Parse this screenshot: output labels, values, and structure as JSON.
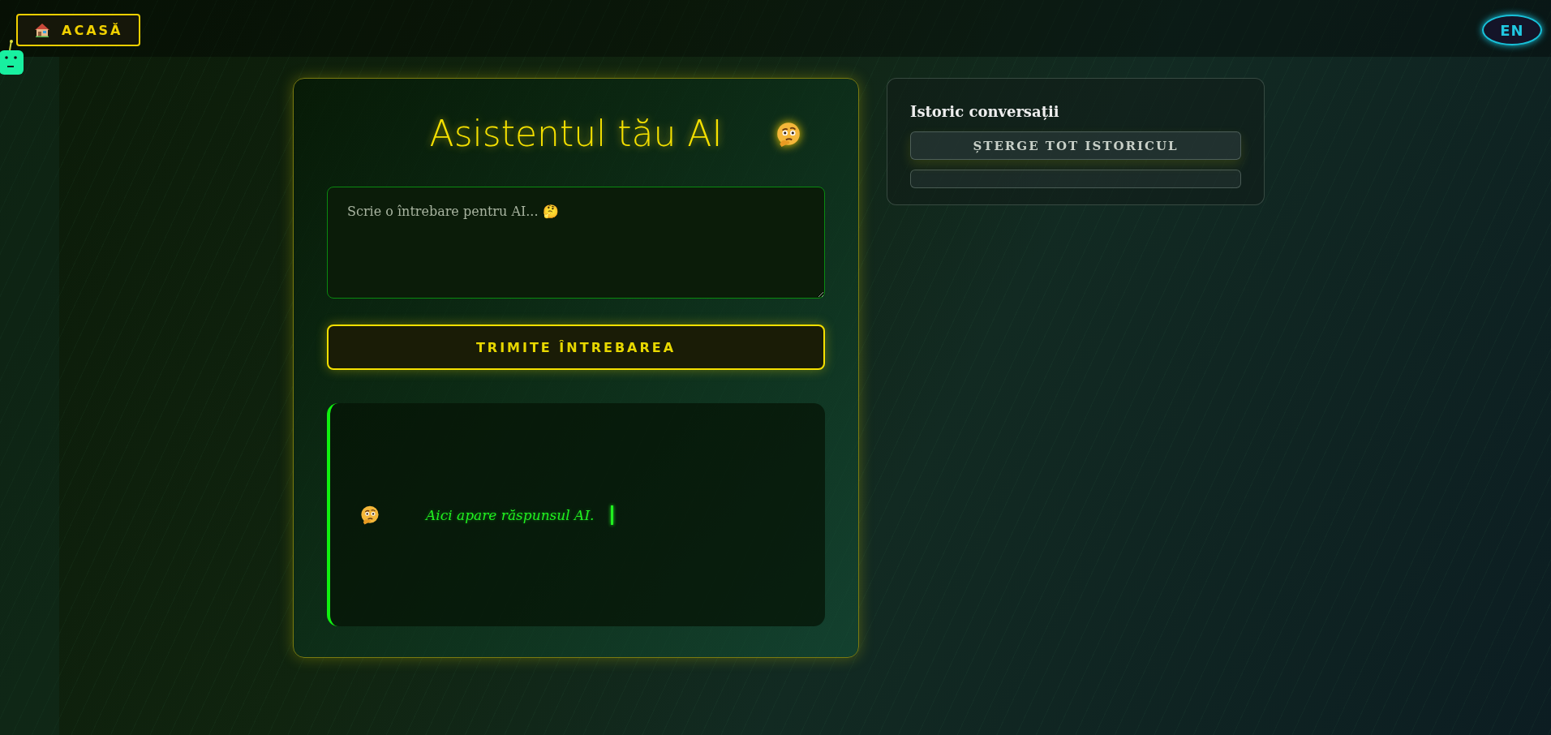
{
  "nav": {
    "home_button": "ACASĂ",
    "language_button": "EN"
  },
  "assistant": {
    "title": "Asistentul tău AI",
    "question": {
      "placeholder": "Scrie o întrebare pentru AI... 🤔"
    },
    "send_button": "TRIMITE ÎNTREBAREA",
    "response": "Aici apare răspunsul AI."
  },
  "history": {
    "title": "Istoric conversații",
    "clear_button": "ȘTERGE TOT ISTORICUL"
  }
}
